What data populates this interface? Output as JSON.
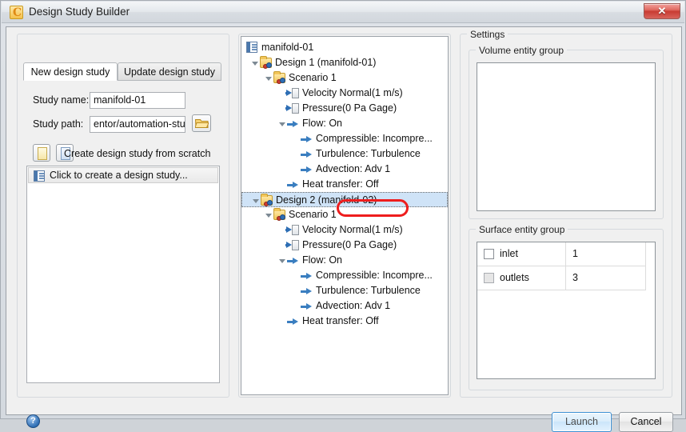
{
  "window": {
    "title": "Design Study Builder",
    "app_icon": "c-logo-icon",
    "close_label": "✕"
  },
  "left_panel": {
    "tabs": [
      {
        "label": "New design study",
        "active": true
      },
      {
        "label": "Update design study",
        "active": false
      }
    ],
    "fields": [
      {
        "label": "Study name:",
        "value": "manifold-01"
      },
      {
        "label": "Study path:",
        "value": "entor/automation-study"
      }
    ],
    "browse_button": "browse-folder-icon",
    "scratch_label": "Create design study from scratch",
    "scratch_buttons": [
      "new-page-icon",
      "blank-page-icon"
    ],
    "list_items": [
      {
        "label": "Click to create a design study...",
        "icon": "design-study-icon"
      }
    ]
  },
  "tree": {
    "nodes": [
      {
        "label": "manifold-01",
        "depth": 0,
        "icon": "study-root-icon",
        "expander": "none",
        "selected": false
      },
      {
        "label": "Design 1 (manifold-01)",
        "depth": 1,
        "icon": "design-folder-icon",
        "expander": "open",
        "selected": false
      },
      {
        "label": "Scenario 1",
        "depth": 2,
        "icon": "scenario-folder-icon",
        "expander": "open",
        "selected": false
      },
      {
        "label": "Velocity Normal(1 m/s)",
        "depth": 3,
        "icon": "boundary-condition-icon",
        "expander": "none",
        "selected": false
      },
      {
        "label": "Pressure(0 Pa Gage)",
        "depth": 3,
        "icon": "boundary-condition-icon",
        "expander": "none",
        "selected": false
      },
      {
        "label": "Flow: On",
        "depth": 3,
        "icon": "physics-arrow-icon",
        "expander": "open",
        "selected": false
      },
      {
        "label": "Compressible: Incompre...",
        "depth": 4,
        "icon": "physics-arrow-icon",
        "expander": "none",
        "selected": false
      },
      {
        "label": "Turbulence: Turbulence",
        "depth": 4,
        "icon": "physics-arrow-icon",
        "expander": "none",
        "selected": false
      },
      {
        "label": "Advection: Adv 1",
        "depth": 4,
        "icon": "physics-arrow-icon",
        "expander": "none",
        "selected": false
      },
      {
        "label": "Heat transfer: Off",
        "depth": 3,
        "icon": "physics-arrow-icon",
        "expander": "none",
        "selected": false
      },
      {
        "label": "Design 2 (manifold-02)",
        "depth": 1,
        "icon": "design-folder-icon",
        "expander": "open",
        "selected": true
      },
      {
        "label": "Scenario 1",
        "depth": 2,
        "icon": "scenario-folder-icon",
        "expander": "open",
        "selected": false
      },
      {
        "label": "Velocity Normal(1 m/s)",
        "depth": 3,
        "icon": "boundary-condition-icon",
        "expander": "none",
        "selected": false
      },
      {
        "label": "Pressure(0 Pa Gage)",
        "depth": 3,
        "icon": "boundary-condition-icon",
        "expander": "none",
        "selected": false
      },
      {
        "label": "Flow: On",
        "depth": 3,
        "icon": "physics-arrow-icon",
        "expander": "open",
        "selected": false
      },
      {
        "label": "Compressible: Incompre...",
        "depth": 4,
        "icon": "physics-arrow-icon",
        "expander": "none",
        "selected": false
      },
      {
        "label": "Turbulence: Turbulence",
        "depth": 4,
        "icon": "physics-arrow-icon",
        "expander": "none",
        "selected": false
      },
      {
        "label": "Advection: Adv 1",
        "depth": 4,
        "icon": "physics-arrow-icon",
        "expander": "none",
        "selected": false
      },
      {
        "label": "Heat transfer: Off",
        "depth": 3,
        "icon": "physics-arrow-icon",
        "expander": "none",
        "selected": false
      }
    ],
    "annotation": {
      "color": "#ee1d1d",
      "around": "(manifold-02)"
    }
  },
  "settings": {
    "title": "Settings",
    "volume_group": {
      "title": "Volume entity group",
      "rows": []
    },
    "surface_group": {
      "title": "Surface entity group",
      "rows": [
        {
          "name": "inlet",
          "value": "1",
          "checked": false,
          "dim": false
        },
        {
          "name": "outlets",
          "value": "3",
          "checked": false,
          "dim": true
        }
      ]
    }
  },
  "footer": {
    "help_icon": "help-icon",
    "help_glyph": "?",
    "launch_label": "Launch",
    "cancel_label": "Cancel"
  }
}
